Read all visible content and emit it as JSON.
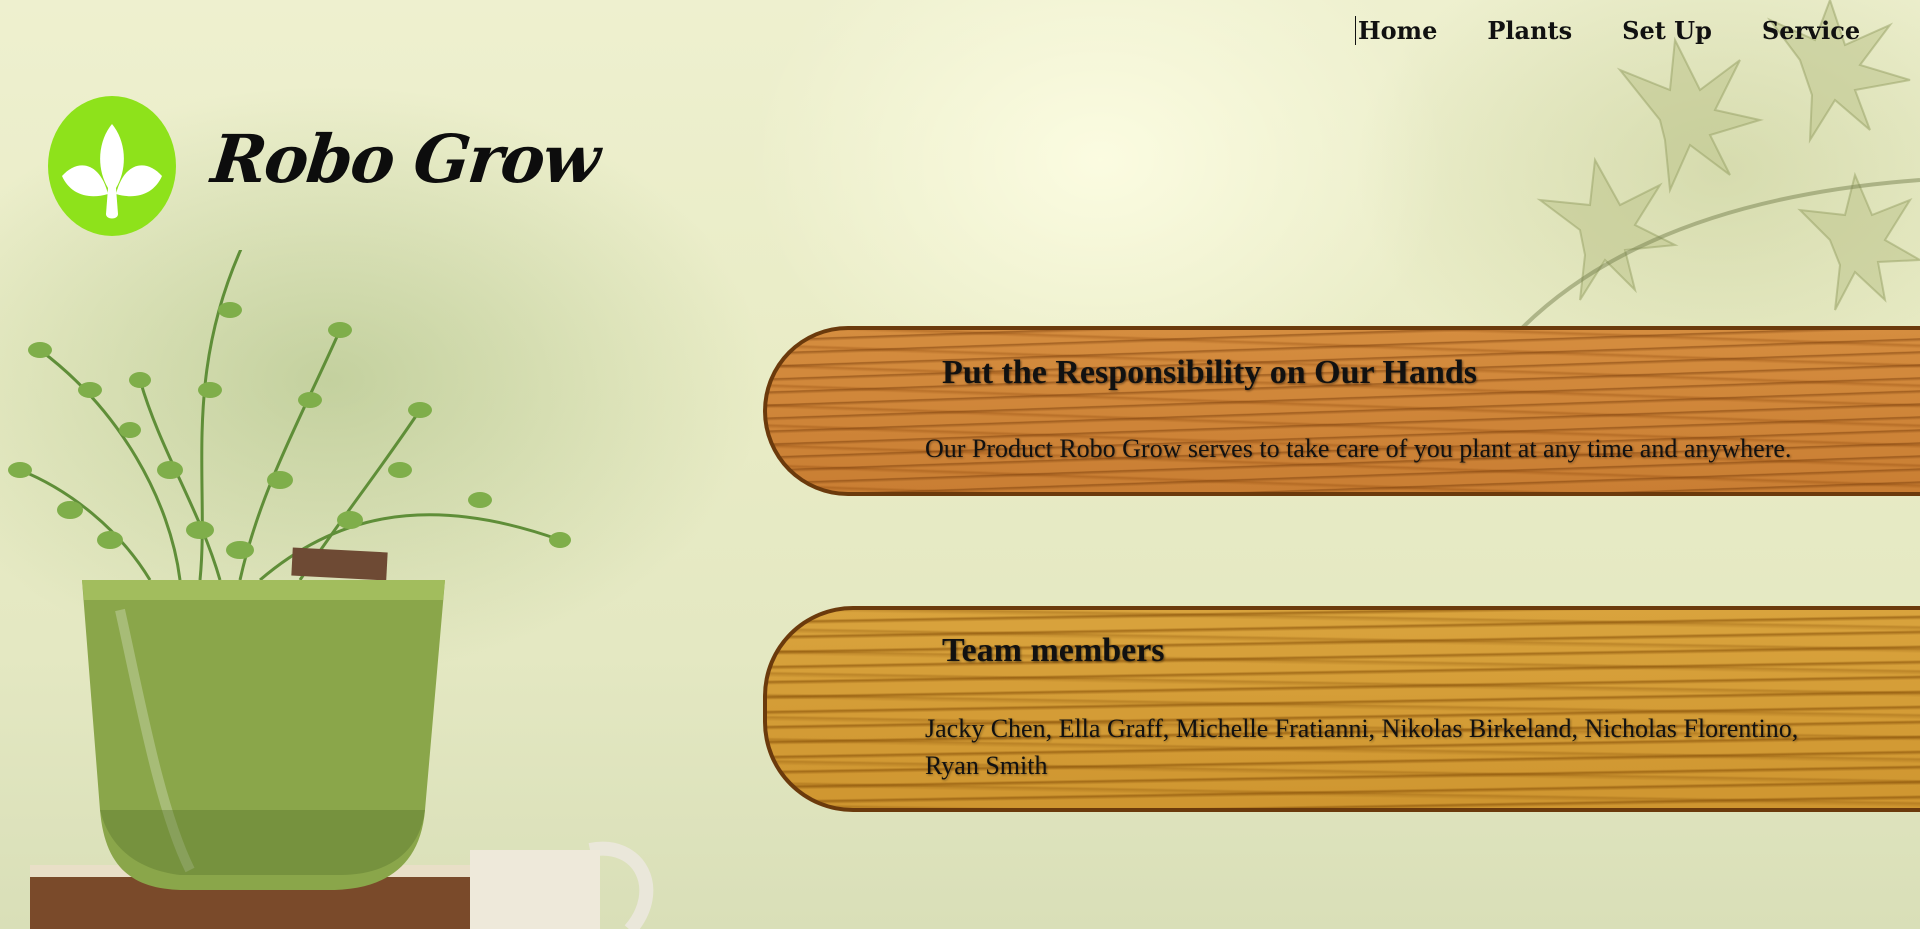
{
  "nav": {
    "items": [
      "Home",
      "Plants",
      "Set Up",
      "Service"
    ]
  },
  "brand": {
    "name": "Robo Grow",
    "logo_icon": "leaf-sprout-icon",
    "logo_color": "#8ee21b"
  },
  "sections": [
    {
      "heading": "Put the Responsibility on Our Hands",
      "text": "Our Product Robo Grow serves to take care of you plant at any time and anywhere."
    },
    {
      "heading": "Team members",
      "text": "Jacky Chen, Ella Graff, Michelle Fratianni, Nikolas Birkeland, Nicholas Florentino, Ryan Smith"
    }
  ],
  "colors": {
    "wood_orange": "#d58d3f",
    "wood_yellow": "#d9a33d",
    "wood_border": "#6b3a0c"
  }
}
